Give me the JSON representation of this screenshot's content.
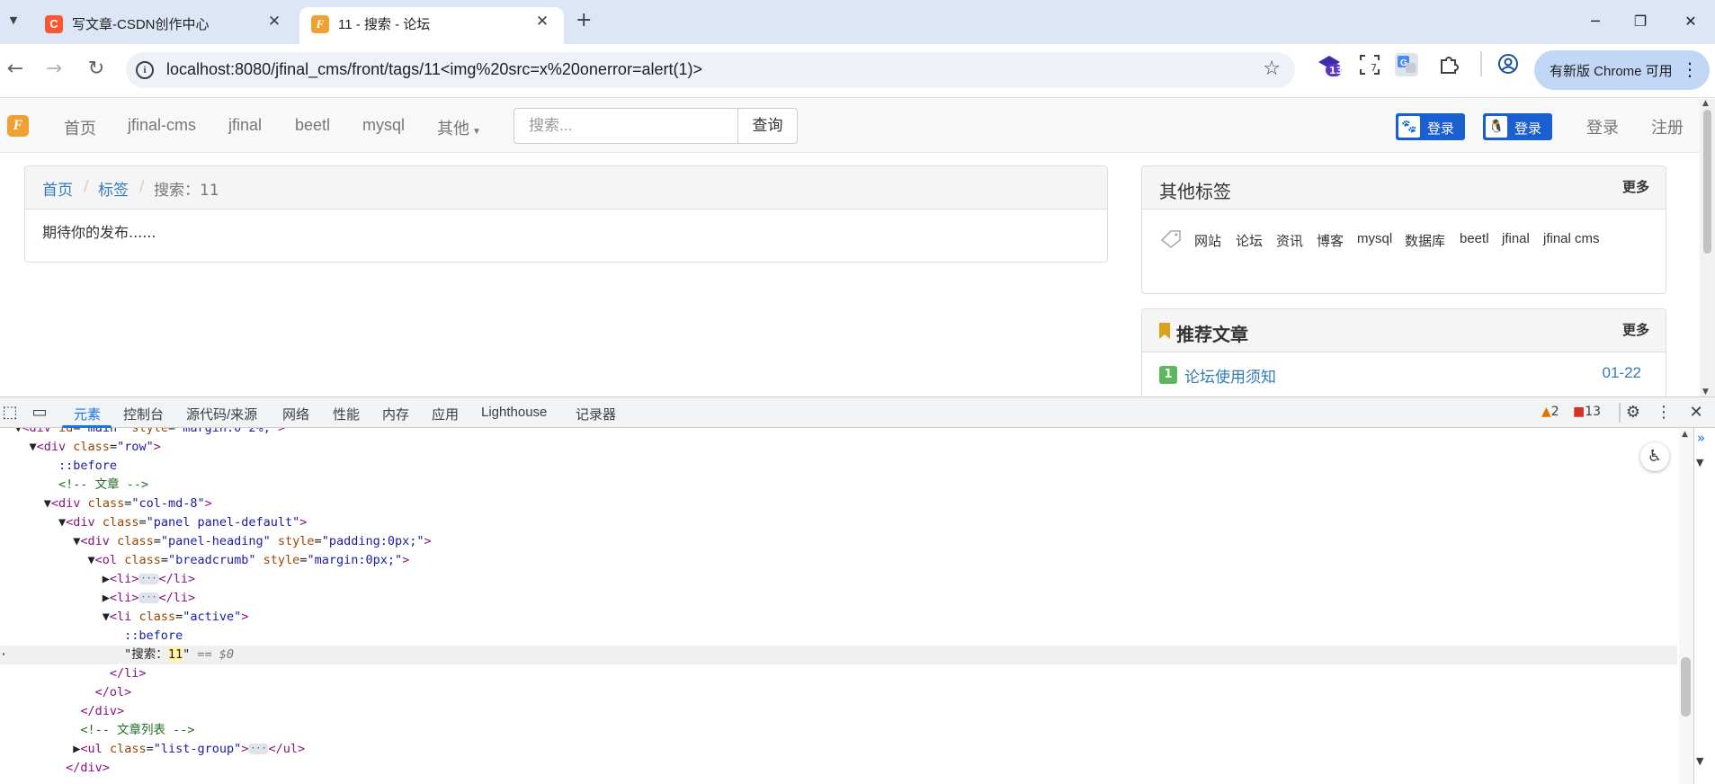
{
  "browser": {
    "tabs": [
      {
        "title": "写文章-CSDN创作中心",
        "favicon": "C",
        "favicon_color": "#fc5531"
      },
      {
        "title": "11 - 搜索 - 论坛",
        "favicon": "F",
        "favicon_color": "#f0a030"
      }
    ],
    "url": "localhost:8080/jfinal_cms/front/tags/11<img%20src=x%20onerror=alert(1)>",
    "update_chip": "有新版 Chrome 可用",
    "ext_badge_count": "13",
    "ext_badge2_count": "7"
  },
  "site": {
    "nav": [
      "首页",
      "jfinal-cms",
      "jfinal",
      "beetl",
      "mysql",
      "其他"
    ],
    "search_placeholder": "搜索...",
    "search_button": "查询",
    "baidu_login": "登录",
    "qq_login": "登录",
    "login": "登录",
    "register": "注册",
    "breadcrumb": {
      "home": "首页",
      "tags": "标签",
      "active": "搜索：11"
    },
    "empty_text": "期待你的发布......",
    "other_tags": {
      "title": "其他标签",
      "more": "更多",
      "tags": [
        "网站",
        "论坛",
        "资讯",
        "博客",
        "mysql",
        "数据库",
        "beetl",
        "jfinal",
        "jfinal cms"
      ]
    },
    "recommend": {
      "title": "推荐文章",
      "more": "更多",
      "items": [
        {
          "rank": "1",
          "title": "论坛使用须知",
          "date": "01-22"
        }
      ]
    }
  },
  "devtools": {
    "tabs": [
      "元素",
      "控制台",
      "源代码/来源",
      "网络",
      "性能",
      "内存",
      "应用",
      "Lighthouse",
      "记录器"
    ],
    "active_tab": "元素",
    "warnings": "2",
    "errors": "13"
  },
  "colors": {
    "accent": "#1a73e8",
    "link": "#337ab7",
    "tabbar": "#dce6f7"
  }
}
